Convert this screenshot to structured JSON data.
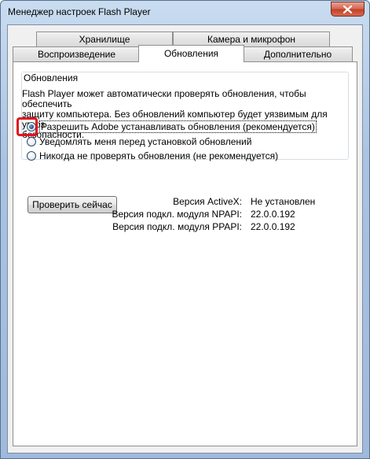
{
  "window": {
    "title": "Менеджер настроек Flash Player"
  },
  "tabs_top": [
    {
      "label": "Хранилище"
    },
    {
      "label": "Камера и микрофон"
    }
  ],
  "tabs_bottom": [
    {
      "label": "Воспроизведение"
    },
    {
      "label": "Обновления",
      "active": true
    },
    {
      "label": "Дополнительно"
    }
  ],
  "updates": {
    "group_title": "Обновления",
    "description_line1": "Flash Player может автоматически проверять обновления, чтобы обеспечить",
    "description_line2": "защиту компьютера. Без обновлений компьютер будет уязвимым для угроз",
    "description_line3": "безопасности.",
    "options": [
      {
        "label": "Разрешить Adobe устанавливать обновления (рекомендуется)",
        "checked": true
      },
      {
        "label": "Уведомлять меня перед установкой обновлений",
        "checked": false
      },
      {
        "label": "Никогда не проверять обновления (не рекомендуется)",
        "checked": false
      }
    ],
    "check_now_button": "Проверить сейчас",
    "versions": [
      {
        "label": "Версия ActiveX:",
        "value": "Не установлен"
      },
      {
        "label": "Версия подкл. модуля NPAPI:",
        "value": "22.0.0.192"
      },
      {
        "label": "Версия подкл. модуля PPAPI:",
        "value": "22.0.0.192"
      }
    ]
  },
  "colors": {
    "highlight": "#e0141e",
    "close_button": "#c2412a"
  },
  "icons": {
    "close": "close-icon"
  }
}
